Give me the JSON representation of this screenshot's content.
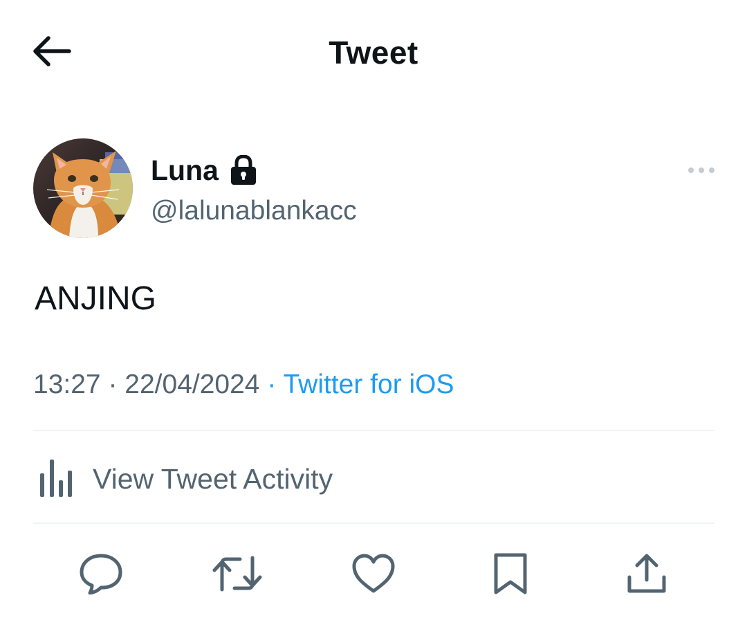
{
  "header": {
    "title": "Tweet",
    "back_icon": "arrow-left-icon"
  },
  "author": {
    "name": "Luna",
    "handle": "@lalunablankacc",
    "protected_icon": "lock-icon",
    "avatar_icon": "cat-avatar",
    "more_icon": "more-horizontal-icon"
  },
  "tweet": {
    "text": "ANJING",
    "time": "13:27",
    "separator": "·",
    "date": "22/04/2024",
    "source": "Twitter for iOS"
  },
  "activity": {
    "label": "View Tweet Activity",
    "icon": "bar-chart-icon"
  },
  "actions": [
    {
      "name": "reply",
      "icon": "reply-icon"
    },
    {
      "name": "retweet",
      "icon": "retweet-icon"
    },
    {
      "name": "like",
      "icon": "heart-icon"
    },
    {
      "name": "bookmark",
      "icon": "bookmark-icon"
    },
    {
      "name": "share",
      "icon": "share-icon"
    }
  ],
  "colors": {
    "text_primary": "#0f1419",
    "text_secondary": "#536471",
    "link": "#1d9bf0",
    "divider": "#eff3f4"
  }
}
